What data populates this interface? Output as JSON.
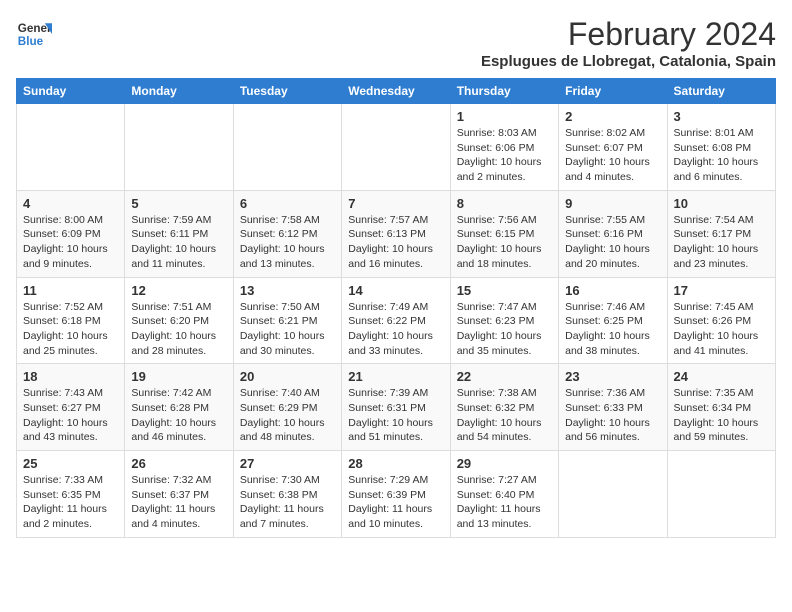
{
  "logo": {
    "line1": "General",
    "line2": "Blue"
  },
  "title": "February 2024",
  "subtitle": "Esplugues de Llobregat, Catalonia, Spain",
  "weekdays": [
    "Sunday",
    "Monday",
    "Tuesday",
    "Wednesday",
    "Thursday",
    "Friday",
    "Saturday"
  ],
  "weeks": [
    [
      {
        "day": "",
        "info": ""
      },
      {
        "day": "",
        "info": ""
      },
      {
        "day": "",
        "info": ""
      },
      {
        "day": "",
        "info": ""
      },
      {
        "day": "1",
        "info": "Sunrise: 8:03 AM\nSunset: 6:06 PM\nDaylight: 10 hours\nand 2 minutes."
      },
      {
        "day": "2",
        "info": "Sunrise: 8:02 AM\nSunset: 6:07 PM\nDaylight: 10 hours\nand 4 minutes."
      },
      {
        "day": "3",
        "info": "Sunrise: 8:01 AM\nSunset: 6:08 PM\nDaylight: 10 hours\nand 6 minutes."
      }
    ],
    [
      {
        "day": "4",
        "info": "Sunrise: 8:00 AM\nSunset: 6:09 PM\nDaylight: 10 hours\nand 9 minutes."
      },
      {
        "day": "5",
        "info": "Sunrise: 7:59 AM\nSunset: 6:11 PM\nDaylight: 10 hours\nand 11 minutes."
      },
      {
        "day": "6",
        "info": "Sunrise: 7:58 AM\nSunset: 6:12 PM\nDaylight: 10 hours\nand 13 minutes."
      },
      {
        "day": "7",
        "info": "Sunrise: 7:57 AM\nSunset: 6:13 PM\nDaylight: 10 hours\nand 16 minutes."
      },
      {
        "day": "8",
        "info": "Sunrise: 7:56 AM\nSunset: 6:15 PM\nDaylight: 10 hours\nand 18 minutes."
      },
      {
        "day": "9",
        "info": "Sunrise: 7:55 AM\nSunset: 6:16 PM\nDaylight: 10 hours\nand 20 minutes."
      },
      {
        "day": "10",
        "info": "Sunrise: 7:54 AM\nSunset: 6:17 PM\nDaylight: 10 hours\nand 23 minutes."
      }
    ],
    [
      {
        "day": "11",
        "info": "Sunrise: 7:52 AM\nSunset: 6:18 PM\nDaylight: 10 hours\nand 25 minutes."
      },
      {
        "day": "12",
        "info": "Sunrise: 7:51 AM\nSunset: 6:20 PM\nDaylight: 10 hours\nand 28 minutes."
      },
      {
        "day": "13",
        "info": "Sunrise: 7:50 AM\nSunset: 6:21 PM\nDaylight: 10 hours\nand 30 minutes."
      },
      {
        "day": "14",
        "info": "Sunrise: 7:49 AM\nSunset: 6:22 PM\nDaylight: 10 hours\nand 33 minutes."
      },
      {
        "day": "15",
        "info": "Sunrise: 7:47 AM\nSunset: 6:23 PM\nDaylight: 10 hours\nand 35 minutes."
      },
      {
        "day": "16",
        "info": "Sunrise: 7:46 AM\nSunset: 6:25 PM\nDaylight: 10 hours\nand 38 minutes."
      },
      {
        "day": "17",
        "info": "Sunrise: 7:45 AM\nSunset: 6:26 PM\nDaylight: 10 hours\nand 41 minutes."
      }
    ],
    [
      {
        "day": "18",
        "info": "Sunrise: 7:43 AM\nSunset: 6:27 PM\nDaylight: 10 hours\nand 43 minutes."
      },
      {
        "day": "19",
        "info": "Sunrise: 7:42 AM\nSunset: 6:28 PM\nDaylight: 10 hours\nand 46 minutes."
      },
      {
        "day": "20",
        "info": "Sunrise: 7:40 AM\nSunset: 6:29 PM\nDaylight: 10 hours\nand 48 minutes."
      },
      {
        "day": "21",
        "info": "Sunrise: 7:39 AM\nSunset: 6:31 PM\nDaylight: 10 hours\nand 51 minutes."
      },
      {
        "day": "22",
        "info": "Sunrise: 7:38 AM\nSunset: 6:32 PM\nDaylight: 10 hours\nand 54 minutes."
      },
      {
        "day": "23",
        "info": "Sunrise: 7:36 AM\nSunset: 6:33 PM\nDaylight: 10 hours\nand 56 minutes."
      },
      {
        "day": "24",
        "info": "Sunrise: 7:35 AM\nSunset: 6:34 PM\nDaylight: 10 hours\nand 59 minutes."
      }
    ],
    [
      {
        "day": "25",
        "info": "Sunrise: 7:33 AM\nSunset: 6:35 PM\nDaylight: 11 hours\nand 2 minutes."
      },
      {
        "day": "26",
        "info": "Sunrise: 7:32 AM\nSunset: 6:37 PM\nDaylight: 11 hours\nand 4 minutes."
      },
      {
        "day": "27",
        "info": "Sunrise: 7:30 AM\nSunset: 6:38 PM\nDaylight: 11 hours\nand 7 minutes."
      },
      {
        "day": "28",
        "info": "Sunrise: 7:29 AM\nSunset: 6:39 PM\nDaylight: 11 hours\nand 10 minutes."
      },
      {
        "day": "29",
        "info": "Sunrise: 7:27 AM\nSunset: 6:40 PM\nDaylight: 11 hours\nand 13 minutes."
      },
      {
        "day": "",
        "info": ""
      },
      {
        "day": "",
        "info": ""
      }
    ]
  ]
}
